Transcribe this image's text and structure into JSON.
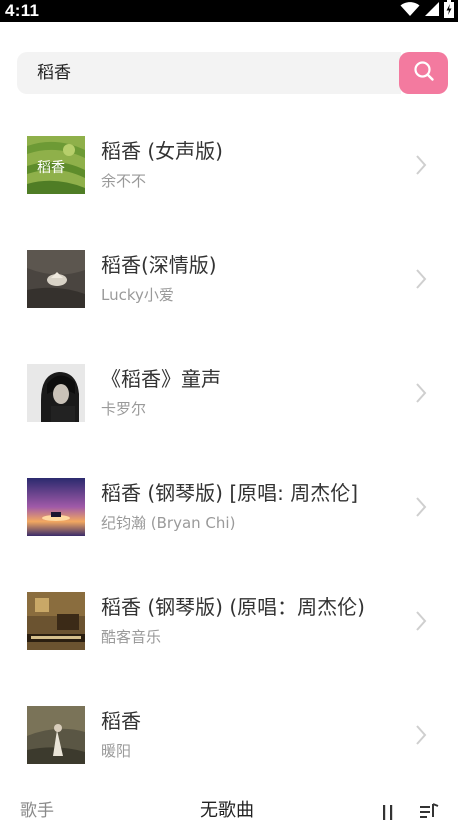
{
  "status_bar": {
    "time": "4:11",
    "icons": [
      "wifi-icon",
      "signal-icon",
      "battery-charging-icon"
    ]
  },
  "search": {
    "query": "稻香",
    "button_icon": "search-icon",
    "accent_color": "#f37a9f"
  },
  "songs": [
    {
      "title": "稻香 (女声版)",
      "artist": "余不不"
    },
    {
      "title": "稻香(深情版)",
      "artist": "Lucky小爱"
    },
    {
      "title": "《稻香》童声",
      "artist": "卡罗尔"
    },
    {
      "title": "稻香 (钢琴版) [原唱: 周杰伦]",
      "artist": "纪钧瀚 (Bryan Chi)"
    },
    {
      "title": "稻香 (钢琴版) (原唱：周杰伦)",
      "artist": "酷客音乐"
    },
    {
      "title": "稻香",
      "artist": "暖阳"
    }
  ],
  "cover_texts": {
    "song1": "稻香"
  },
  "player": {
    "artist": "歌手",
    "song": "无歌曲",
    "pause_icon": "pause-icon",
    "playlist_icon": "playlist-icon"
  }
}
